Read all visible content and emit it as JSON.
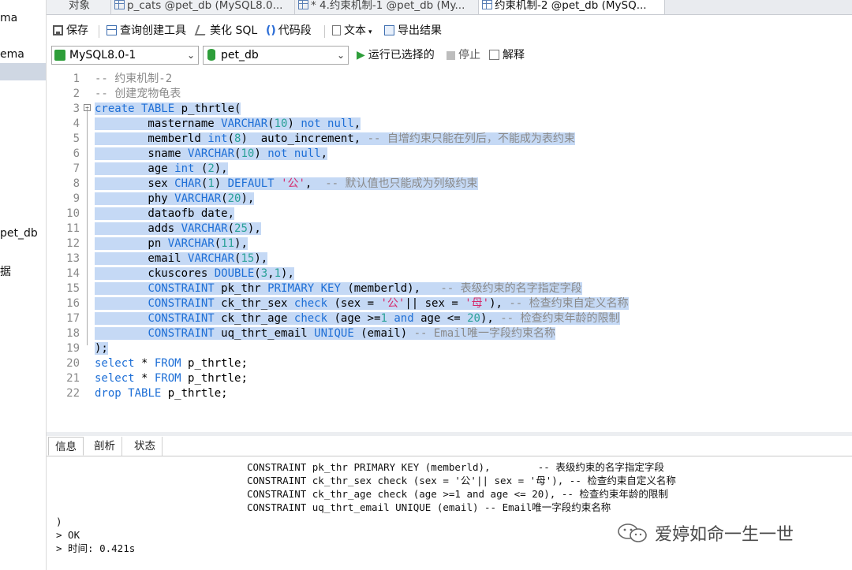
{
  "left_panel": {
    "items": [
      "ma",
      "ema",
      "pet_db",
      "据"
    ]
  },
  "tabs": [
    {
      "label": "对象",
      "active": false
    },
    {
      "label": "p_cats @pet_db (MySQL8.0...",
      "active": false
    },
    {
      "label": "* 4.约束机制-1 @pet_db (My...",
      "active": false
    },
    {
      "label": "约束机制-2 @pet_db (MySQ...",
      "active": true
    }
  ],
  "toolbar": {
    "save": "保存",
    "query_builder": "查询创建工具",
    "beautify": "美化 SQL",
    "code_snippet": "代码段",
    "text": "文本",
    "export": "导出结果",
    "connection": "MySQL8.0-1",
    "database": "pet_db",
    "run_selected": "运行已选择的",
    "stop": "停止",
    "explain": "解释"
  },
  "editor": {
    "lines": [
      {
        "n": "1",
        "tokens": [
          [
            "cm",
            "-- 约束机制-2"
          ]
        ]
      },
      {
        "n": "2",
        "tokens": [
          [
            "cm",
            "-- 创建宠物龟表"
          ]
        ]
      },
      {
        "n": "3",
        "tokens": [
          [
            "kw",
            "create"
          ],
          [
            "",
            " "
          ],
          [
            "kw",
            "TABLE"
          ],
          [
            "",
            " p_thrtle("
          ]
        ]
      },
      {
        "n": "4",
        "tokens": [
          [
            "",
            "        mastername "
          ],
          [
            "kw",
            "VARCHAR"
          ],
          [
            "",
            "("
          ],
          [
            "num",
            "10"
          ],
          [
            "",
            ") "
          ],
          [
            "kw",
            "not null"
          ],
          [
            "",
            ","
          ]
        ]
      },
      {
        "n": "5",
        "tokens": [
          [
            "",
            "        memberld "
          ],
          [
            "kw",
            "int"
          ],
          [
            "",
            "("
          ],
          [
            "num",
            "8"
          ],
          [
            "",
            ")  auto_increment, "
          ],
          [
            "cm",
            "-- 自增约束只能在列后，不能成为表约束"
          ]
        ]
      },
      {
        "n": "6",
        "tokens": [
          [
            "",
            "        sname "
          ],
          [
            "kw",
            "VARCHAR"
          ],
          [
            "",
            "("
          ],
          [
            "num",
            "10"
          ],
          [
            "",
            ") "
          ],
          [
            "kw",
            "not null"
          ],
          [
            "",
            ","
          ]
        ]
      },
      {
        "n": "7",
        "tokens": [
          [
            "",
            "        age "
          ],
          [
            "kw",
            "int"
          ],
          [
            "",
            " ("
          ],
          [
            "num",
            "2"
          ],
          [
            "",
            "),"
          ]
        ]
      },
      {
        "n": "8",
        "tokens": [
          [
            "",
            "        sex "
          ],
          [
            "kw",
            "CHAR"
          ],
          [
            "",
            "("
          ],
          [
            "num",
            "1"
          ],
          [
            "",
            ") "
          ],
          [
            "kw",
            "DEFAULT"
          ],
          [
            "",
            " "
          ],
          [
            "str",
            "'公'"
          ],
          [
            "",
            ",  "
          ],
          [
            "cm",
            "-- 默认值也只能成为列级约束"
          ]
        ]
      },
      {
        "n": "9",
        "tokens": [
          [
            "",
            "        phy "
          ],
          [
            "kw",
            "VARCHAR"
          ],
          [
            "",
            "("
          ],
          [
            "num",
            "20"
          ],
          [
            "",
            "),"
          ]
        ]
      },
      {
        "n": "10",
        "tokens": [
          [
            "",
            "        dataofb date,"
          ]
        ]
      },
      {
        "n": "11",
        "tokens": [
          [
            "",
            "        adds "
          ],
          [
            "kw",
            "VARCHAR"
          ],
          [
            "",
            "("
          ],
          [
            "num",
            "25"
          ],
          [
            "",
            "),"
          ]
        ]
      },
      {
        "n": "12",
        "tokens": [
          [
            "",
            "        pn "
          ],
          [
            "kw",
            "VARCHAR"
          ],
          [
            "",
            "("
          ],
          [
            "num",
            "11"
          ],
          [
            "",
            "),"
          ]
        ]
      },
      {
        "n": "13",
        "tokens": [
          [
            "",
            "        email "
          ],
          [
            "kw",
            "VARCHAR"
          ],
          [
            "",
            "("
          ],
          [
            "num",
            "15"
          ],
          [
            "",
            "),"
          ]
        ]
      },
      {
        "n": "14",
        "tokens": [
          [
            "",
            "        ckuscores "
          ],
          [
            "kw",
            "DOUBLE"
          ],
          [
            "",
            "("
          ],
          [
            "num",
            "3"
          ],
          [
            "",
            ","
          ],
          [
            "num",
            "1"
          ],
          [
            "",
            "),"
          ]
        ]
      },
      {
        "n": "15",
        "tokens": [
          [
            "",
            "        "
          ],
          [
            "kw",
            "CONSTRAINT"
          ],
          [
            "",
            " pk_thr "
          ],
          [
            "kw",
            "PRIMARY KEY"
          ],
          [
            "",
            " (memberld),   "
          ],
          [
            "cm",
            "-- 表级约束的名字指定字段"
          ]
        ]
      },
      {
        "n": "16",
        "tokens": [
          [
            "",
            "        "
          ],
          [
            "kw",
            "CONSTRAINT"
          ],
          [
            "",
            " ck_thr_sex "
          ],
          [
            "kw",
            "check"
          ],
          [
            "",
            " (sex = "
          ],
          [
            "str",
            "'公'"
          ],
          [
            "",
            "|| sex = "
          ],
          [
            "str",
            "'母'"
          ],
          [
            "",
            "), "
          ],
          [
            "cm",
            "-- 检查约束自定义名称"
          ]
        ]
      },
      {
        "n": "17",
        "tokens": [
          [
            "",
            "        "
          ],
          [
            "kw",
            "CONSTRAINT"
          ],
          [
            "",
            " ck_thr_age "
          ],
          [
            "kw",
            "check"
          ],
          [
            "",
            " (age >="
          ],
          [
            "num",
            "1"
          ],
          [
            "",
            " "
          ],
          [
            "kw",
            "and"
          ],
          [
            "",
            " age <= "
          ],
          [
            "num",
            "20"
          ],
          [
            "",
            "), "
          ],
          [
            "cm",
            "-- 检查约束年龄的限制"
          ]
        ]
      },
      {
        "n": "18",
        "tokens": [
          [
            "",
            "        "
          ],
          [
            "kw",
            "CONSTRAINT"
          ],
          [
            "",
            " uq_thrt_email "
          ],
          [
            "kw",
            "UNIQUE"
          ],
          [
            "",
            " (email) "
          ],
          [
            "cm",
            "-- Email唯一字段约束名称"
          ]
        ]
      },
      {
        "n": "19",
        "tokens": [
          [
            "",
            ");"
          ]
        ]
      },
      {
        "n": "20",
        "tokens": [
          [
            "kw",
            "select"
          ],
          [
            "",
            " * "
          ],
          [
            "kw",
            "FROM"
          ],
          [
            "",
            " p_thrtle;"
          ]
        ]
      },
      {
        "n": "21",
        "tokens": [
          [
            "kw",
            "select"
          ],
          [
            "",
            " * "
          ],
          [
            "kw",
            "FROM"
          ],
          [
            "",
            " p_thrtle;"
          ]
        ]
      },
      {
        "n": "22",
        "tokens": [
          [
            "kw",
            "drop"
          ],
          [
            "",
            " "
          ],
          [
            "kw",
            "TABLE"
          ],
          [
            "",
            " p_thrtle;"
          ]
        ]
      }
    ]
  },
  "output_tabs": [
    "信息",
    "剖析",
    "状态"
  ],
  "output": {
    "lines": [
      "CONSTRAINT pk_thr PRIMARY KEY (memberld),        -- 表级约束的名字指定字段",
      "CONSTRAINT ck_thr_sex check (sex = '公'|| sex = '母'), -- 检查约束自定义名称",
      "CONSTRAINT ck_thr_age check (age >=1 and age <= 20), -- 检查约束年龄的限制",
      "CONSTRAINT uq_thrt_email UNIQUE (email) -- Email唯一字段约束名称"
    ],
    "close_paren": ")",
    "ok": "> OK",
    "time": "> 时间: 0.421s"
  },
  "watermark": "爱婷如命一生一世",
  "colors": {
    "selection": "#c5d9f5",
    "keyword": "#1e6fd6",
    "number": "#2aa198",
    "string": "#d62b6b",
    "comment": "#8a8a8a",
    "run_green": "#2e9e3a"
  }
}
